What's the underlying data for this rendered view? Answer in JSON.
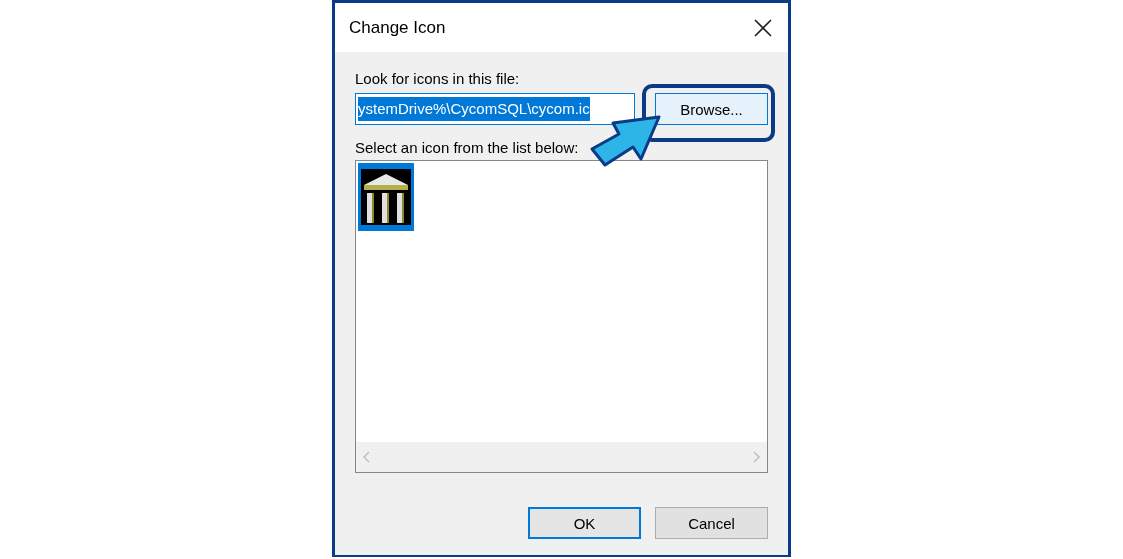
{
  "window": {
    "title": "Change Icon"
  },
  "file_label": "Look for icons in this file:",
  "file_field": {
    "value": "ystemDrive%\\CycomSQL\\cycom.ic",
    "text_selected": true
  },
  "browse_button": {
    "label": "Browse...",
    "highlighted": true
  },
  "list_label": "Select an icon from the list below:",
  "icons": [
    {
      "kind": "temple",
      "selected": true
    }
  ],
  "buttons": [
    {
      "label": "OK",
      "default": true
    },
    {
      "label": "Cancel",
      "default": false
    }
  ]
}
